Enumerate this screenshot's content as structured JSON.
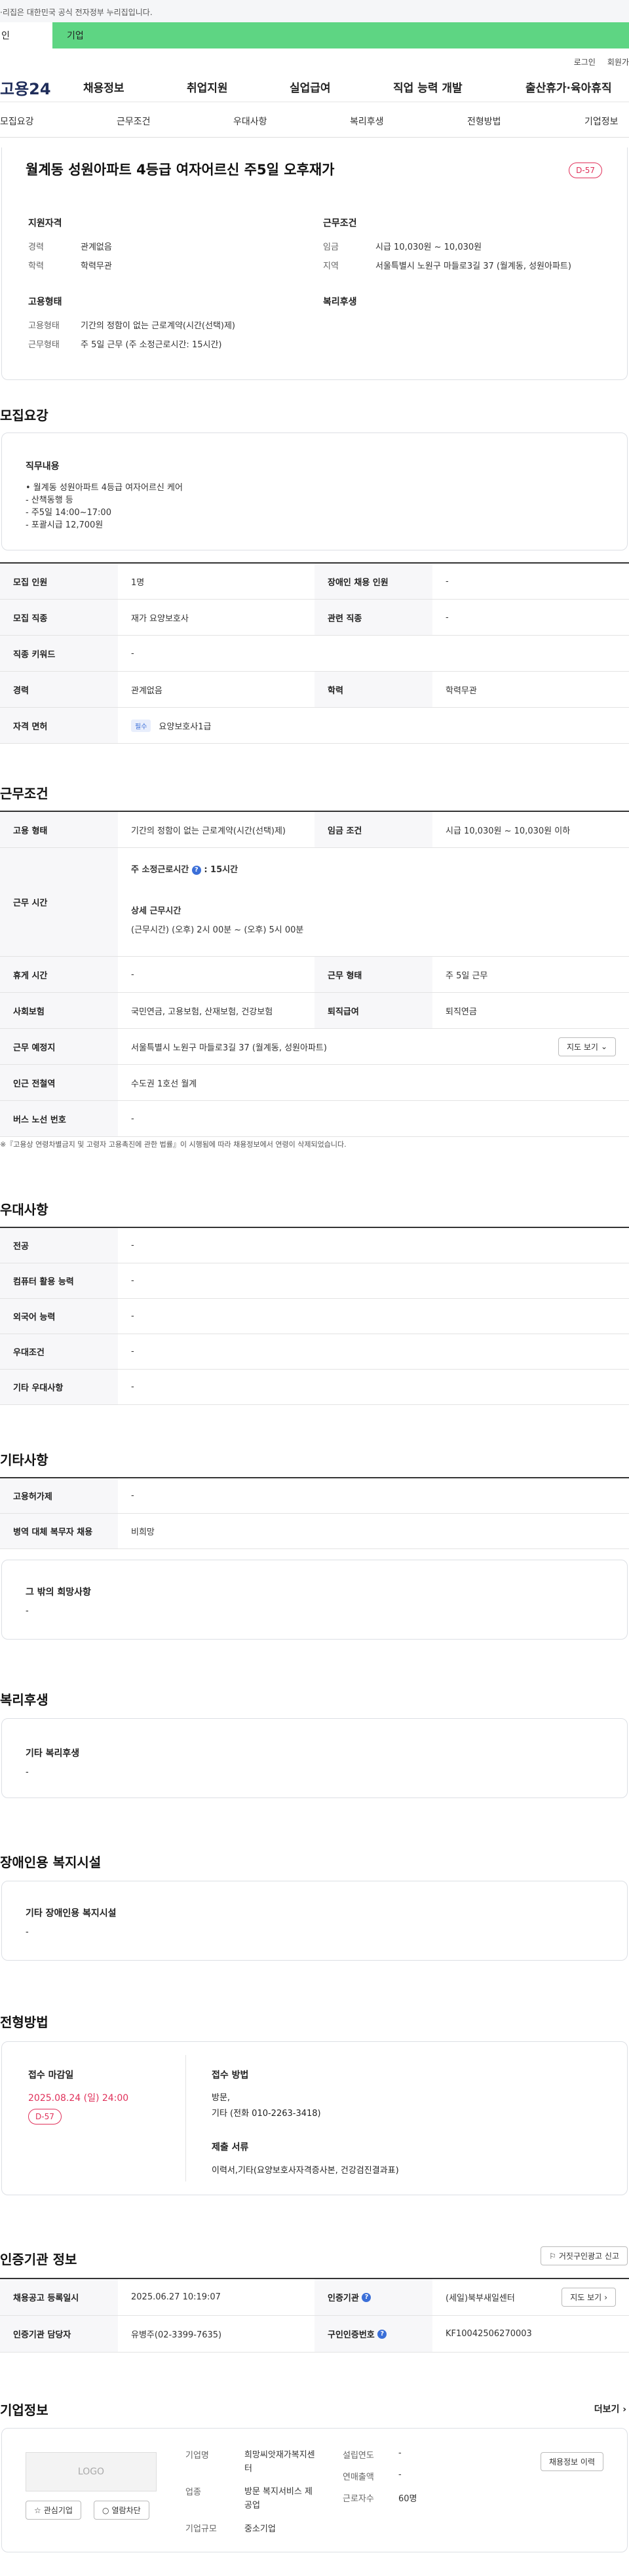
{
  "gov_banner": "·리집은 대한민국 공식 전자정부 누리집입니다.",
  "user_tabs": [
    "인",
    "기업"
  ],
  "util_links": [
    "로그인",
    "회원가"
  ],
  "logo": "고용24",
  "gnb": [
    "채용정보",
    "취업지원",
    "실업급여",
    "직업 능력 개발",
    "출산휴가·육아휴직"
  ],
  "subnav": [
    "모집요강",
    "근무조건",
    "우대사항",
    "복리후생",
    "전형방법",
    "기업정보"
  ],
  "job": {
    "title": "월계동 성원아파트 4등급 여자어르신 주5일 오후재가",
    "dday": "D-57",
    "qual_heading": "지원자격",
    "qual": [
      {
        "label": "경력",
        "value": "관계없음"
      },
      {
        "label": "학력",
        "value": "학력무관"
      }
    ],
    "cond_heading": "근무조건",
    "cond": [
      {
        "label": "임금",
        "value": "시급 10,030원 ~ 10,030원"
      },
      {
        "label": "지역",
        "value": "서울특별시 노원구 마들로3길 37 (월계동, 성원아파트)"
      }
    ],
    "emp_heading": "고용형태",
    "emp": [
      {
        "label": "고용형태",
        "value": "기간의 정함이 없는 근로계약(시간(선택)제)"
      },
      {
        "label": "근무형태",
        "value": "주 5일 근무 (주 소정근로시간: 15시간)"
      }
    ],
    "welfare_heading": "복리후생"
  },
  "recruit": {
    "title": "모집요강",
    "duty_heading": "직무내용",
    "duty_lines": [
      "• 월계동 성원아파트 4등급 여자어르신 케어",
      "- 산책동행 등",
      "- 주5일 14:00~17:00",
      "- 포괄시급 12,700원"
    ],
    "rows": [
      {
        "k1": "모집 인원",
        "v1": "1명",
        "k2": "장애인 채용 인원",
        "v2": "-"
      },
      {
        "k1": "모집 직종",
        "v1": "재가 요양보호사",
        "k2": "관련 직종",
        "v2": "-"
      },
      {
        "k1": "직종 키워드",
        "v1": "-"
      },
      {
        "k1": "경력",
        "v1": "관계없음",
        "k2": "학력",
        "v2": "학력무관"
      },
      {
        "k1": "자격 면허",
        "badge": "필수",
        "v1": "요양보호사1급"
      }
    ]
  },
  "work": {
    "title": "근무조건",
    "emp_type_k": "고용 형태",
    "emp_type_v": "기간의 정함이 없는 근로계약(시간(선택)제)",
    "wage_k": "임금 조건",
    "wage_v": "시급 10,030원 ~ 10,030원 이하",
    "hours_k": "근무 시간",
    "hours_weekly": "주 소정근로시간",
    "hours_weekly_val": ": 15시간",
    "hours_detail_h": "상세 근무시간",
    "hours_detail": "(근무시간) (오후) 2시 00분 ~ (오후) 5시 00분",
    "rest_k": "휴게 시간",
    "rest_v": "-",
    "form_k": "근무 형태",
    "form_v": "주 5일 근무",
    "ins_k": "사회보험",
    "ins_v": "국민연금, 고용보험, 산재보험, 건강보험",
    "ret_k": "퇴직급여",
    "ret_v": "퇴직연금",
    "place_k": "근무 예정지",
    "place_v": "서울특별시 노원구 마들로3길 37 (월계동, 성원아파트)",
    "map_btn": "지도 보기",
    "subway_k": "인근 전철역",
    "subway_v": "수도권 1호선 월계",
    "bus_k": "버스 노선 번호",
    "bus_v": "-",
    "note": "※『고용상 연령차별금지 및 고령자 고용촉진에 관한 법률』이 시행됨에 따라 채용정보에서 연령이 삭제되었습니다."
  },
  "pref": {
    "title": "우대사항",
    "rows": [
      {
        "k": "전공",
        "v": "-"
      },
      {
        "k": "컴퓨터 활용 능력",
        "v": "-"
      },
      {
        "k": "외국어 능력",
        "v": "-"
      },
      {
        "k": "우대조건",
        "v": "-"
      },
      {
        "k": "기타 우대사항",
        "v": "-"
      }
    ]
  },
  "etc": {
    "title": "기타사항",
    "rows": [
      {
        "k": "고용허가제",
        "v": "-"
      },
      {
        "k": "병역 대체 복무자 채용",
        "v": "비희망"
      }
    ],
    "hope_h": "그 밖의 희망사항",
    "hope_v": "-"
  },
  "welfare": {
    "title": "복리후생",
    "h": "기타 복리후생",
    "v": "-"
  },
  "disabled": {
    "title": "장애인용 복지시설",
    "h": "기타 장애인용 복지시설",
    "v": "-"
  },
  "process": {
    "title": "전형방법",
    "deadline_h": "접수 마감일",
    "deadline": "2025.08.24 (일) 24:00",
    "dday": "D-57",
    "method_h": "접수 방법",
    "method_lines": [
      "방문,",
      "기타 (전화 010-2263-3418)"
    ],
    "docs_h": "제출 서류",
    "docs": "이력서,기타(요양보호사자격증사본, 건강검진결과표)"
  },
  "cert": {
    "title": "인증기관 정보",
    "report_btn": "거짓구인광고 신고",
    "reg_k": "채용공고 등록일시",
    "reg_v": "2025.06.27 10:19:07",
    "org_k": "인증기관",
    "org_v": "(세일)북부새일센터",
    "map_btn": "지도 보기",
    "mgr_k": "인증기관 담당자",
    "mgr_v": "유병주(02-3399-7635)",
    "no_k": "구인인증번호",
    "no_v": "KF10042506270003"
  },
  "company": {
    "title": "기업정보",
    "more": "더보기",
    "logo": "LOGO",
    "fav_btn": "관심기업",
    "block_btn": "열람차단",
    "name_k": "기업명",
    "name_v": "희망씨앗재가복지센터",
    "industry_k": "업종",
    "industry_v": "방문 복지서비스 제공업",
    "size_k": "기업규모",
    "size_v": "중소기업",
    "year_k": "설립연도",
    "year_v": "-",
    "sales_k": "연매출액",
    "sales_v": "-",
    "emp_k": "근로자수",
    "emp_v": "60명",
    "btn": "채용정보 이력"
  }
}
